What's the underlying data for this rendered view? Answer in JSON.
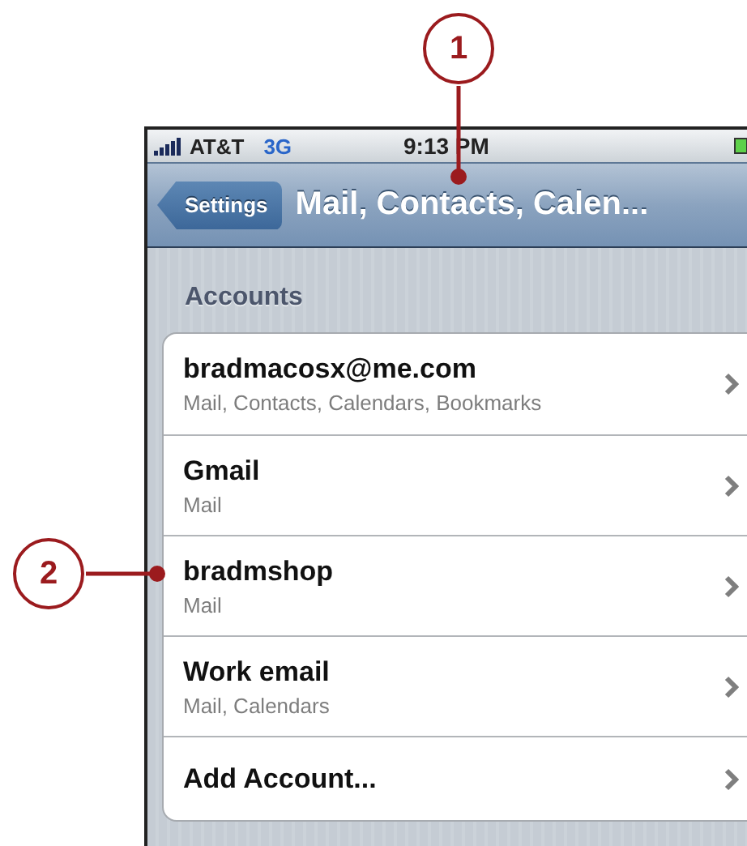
{
  "callouts": [
    {
      "number": "1",
      "kind": "top"
    },
    {
      "number": "2",
      "kind": "left"
    }
  ],
  "status_bar": {
    "carrier": "AT&T",
    "network": "3G",
    "time": "9:13 PM"
  },
  "nav_bar": {
    "back_button": "Settings",
    "title": "Mail, Contacts, Calen..."
  },
  "section": {
    "header": "Accounts",
    "rows": [
      {
        "title": "bradmacosx@me.com",
        "subtitle": "Mail, Contacts, Calendars, Bookmarks"
      },
      {
        "title": "Gmail",
        "subtitle": "Mail"
      },
      {
        "title": "bradmshop",
        "subtitle": "Mail"
      },
      {
        "title": "Work email",
        "subtitle": "Mail, Calendars"
      },
      {
        "title": "Add Account..."
      }
    ]
  }
}
